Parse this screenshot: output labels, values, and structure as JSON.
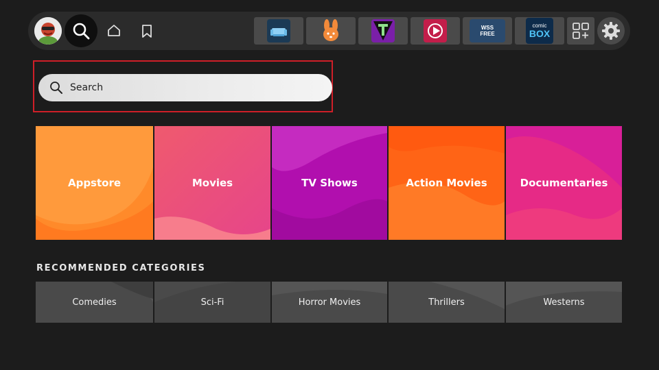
{
  "nav": {
    "avatar_icon": "avatar-icon",
    "items": [
      {
        "icon": "search-icon"
      },
      {
        "icon": "home-icon"
      },
      {
        "icon": "bookmark-icon"
      }
    ],
    "apps": [
      {
        "icon": "couch-app-icon"
      },
      {
        "icon": "rabbit-app-icon"
      },
      {
        "icon": "tubi-app-icon"
      },
      {
        "icon": "play-app-icon"
      },
      {
        "icon": "wss-app-icon",
        "text": "WSS FREE"
      },
      {
        "icon": "comicbox-app-icon",
        "text_top": "comic",
        "text_bottom": "BOX"
      }
    ],
    "apps_grid_icon": "apps-grid-icon",
    "settings_icon": "gear-icon"
  },
  "search": {
    "label": "Search",
    "highlight_color": "#d01f28"
  },
  "categories": [
    {
      "label": "Appstore",
      "color": "#ff8f2e"
    },
    {
      "label": "Movies",
      "color": "#f0577a"
    },
    {
      "label": "TV Shows",
      "color": "#b814b0"
    },
    {
      "label": "Action Movies",
      "color": "#ff6a14"
    },
    {
      "label": "Documentaries",
      "color": "#e8288a"
    }
  ],
  "recommended": {
    "title": "RECOMMENDED CATEGORIES",
    "items": [
      {
        "label": "Comedies"
      },
      {
        "label": "Sci-Fi"
      },
      {
        "label": "Horror Movies"
      },
      {
        "label": "Thrillers"
      },
      {
        "label": "Westerns"
      }
    ]
  }
}
